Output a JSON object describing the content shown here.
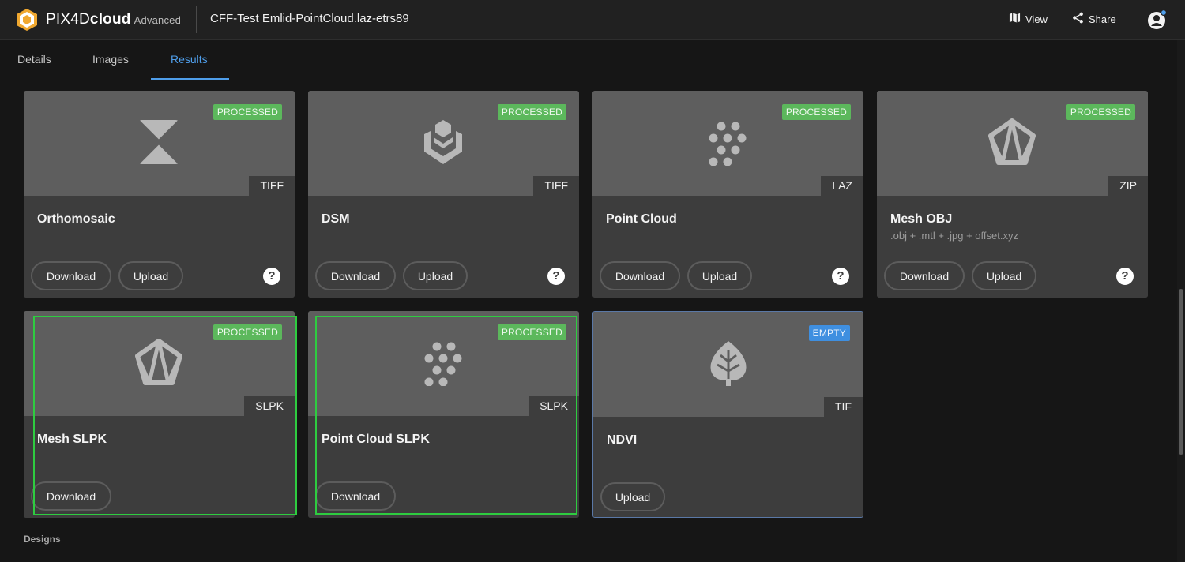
{
  "header": {
    "brand_pix4d": "PIX4D",
    "brand_cloud": "cloud",
    "brand_tier": "Advanced",
    "project_title": "CFF-Test Emlid-PointCloud.laz-etrs89",
    "view_label": "View",
    "share_label": "Share"
  },
  "tabs": [
    {
      "label": "Details"
    },
    {
      "label": "Images"
    },
    {
      "label": "Results",
      "active": true
    }
  ],
  "cards": [
    {
      "title": "Orthomosaic",
      "subtitle": "",
      "status": "PROCESSED",
      "format": "TIFF",
      "icon": "orthomosaic-icon",
      "download": "Download",
      "upload": "Upload",
      "help": "?"
    },
    {
      "title": "DSM",
      "subtitle": "",
      "status": "PROCESSED",
      "format": "TIFF",
      "icon": "dsm-icon",
      "download": "Download",
      "upload": "Upload",
      "help": "?"
    },
    {
      "title": "Point Cloud",
      "subtitle": "",
      "status": "PROCESSED",
      "format": "LAZ",
      "icon": "point-cloud-icon",
      "download": "Download",
      "upload": "Upload",
      "help": "?"
    },
    {
      "title": "Mesh OBJ",
      "subtitle": ".obj + .mtl + .jpg + offset.xyz",
      "status": "PROCESSED",
      "format": "ZIP",
      "icon": "mesh-icon",
      "download": "Download",
      "upload": "Upload",
      "help": "?"
    },
    {
      "title": "Mesh SLPK",
      "subtitle": "",
      "status": "PROCESSED",
      "format": "SLPK",
      "icon": "mesh-icon",
      "download": "Download"
    },
    {
      "title": "Point Cloud SLPK",
      "subtitle": "",
      "status": "PROCESSED",
      "format": "SLPK",
      "icon": "point-cloud-icon",
      "download": "Download"
    },
    {
      "title": "NDVI",
      "subtitle": "",
      "status": "EMPTY",
      "format": "TIF",
      "icon": "leaf-icon",
      "upload": "Upload"
    }
  ],
  "section": {
    "designs_label": "Designs"
  },
  "colors": {
    "accent": "#4f9eea",
    "processed": "#5cb85c",
    "empty": "#3f8fe0",
    "selection": "#2ecc40"
  }
}
